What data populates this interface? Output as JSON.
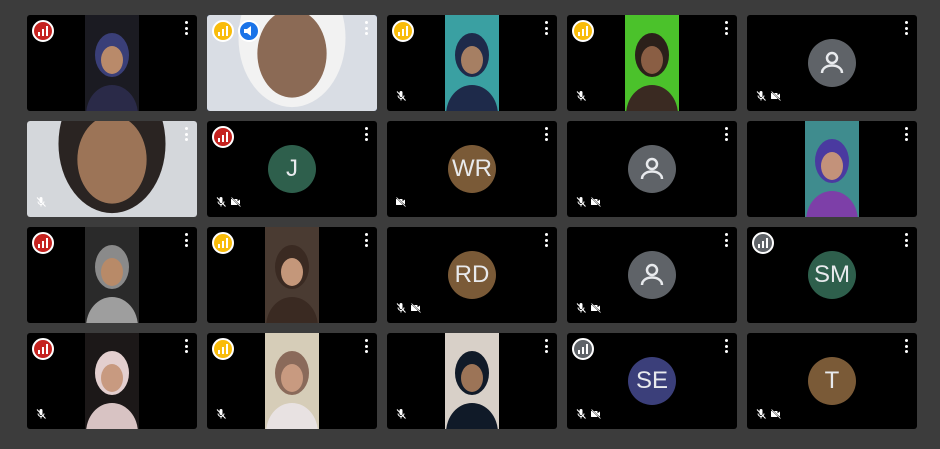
{
  "colors": {
    "background": "#3c3c3c",
    "tile": "#000000",
    "active_border": "#2f6ed6",
    "signal_red": "#c5221f",
    "signal_yellow": "#f9bc0a",
    "signal_gray": "#5f6368",
    "presenting_blue": "#1a73e8"
  },
  "participants": [
    {
      "kind": "video",
      "signal": "red",
      "mic_off": false,
      "cam_off": false,
      "bg": "#1b1b22",
      "face": "#b98a6a",
      "cloth": "#2a2a48",
      "hijab": "#3a3f78"
    },
    {
      "kind": "video",
      "signal": "yellow",
      "presenting": true,
      "active": true,
      "mic_off": false,
      "cam_off": false,
      "bg": "#d9dde4",
      "face": "#8b6a55",
      "cloth": "#e8e8ec",
      "hijab": "#f2f2f2",
      "wide": true
    },
    {
      "kind": "video",
      "signal": "yellow",
      "mic_off": true,
      "cam_off": false,
      "bg": "#3aa0a2",
      "face": "#a67f63",
      "cloth": "#1e2a4a",
      "hijab": "#1e2a4a"
    },
    {
      "kind": "video",
      "signal": "yellow",
      "mic_off": true,
      "cam_off": false,
      "bg": "#4bc22b",
      "face": "#8a5e44",
      "cloth": "#3a2a22",
      "hijab": "#2b201a"
    },
    {
      "kind": "person",
      "mic_off": true,
      "cam_off": true
    },
    {
      "kind": "video",
      "mic_off": true,
      "cam_off": false,
      "bg": "#d4d7db",
      "face": "#9c7457",
      "cloth": "#4c5560",
      "hijab": "#2a2422",
      "wide": true
    },
    {
      "kind": "initials",
      "initials": "J",
      "color": "#2e5f4c",
      "signal": "red",
      "mic_off": true,
      "cam_off": true
    },
    {
      "kind": "initials",
      "initials": "WR",
      "color": "#7a5a37",
      "mic_off": false,
      "cam_off": true
    },
    {
      "kind": "person",
      "mic_off": true,
      "cam_off": true
    },
    {
      "kind": "video",
      "mic_off": false,
      "cam_off": false,
      "bg": "#3f8c8e",
      "face": "#c3927a",
      "cloth": "#7d3fa8",
      "hijab": "#4a3aa0"
    },
    {
      "kind": "video",
      "signal": "red",
      "mic_off": false,
      "cam_off": false,
      "bg": "#2a2a2a",
      "face": "#b88a68",
      "cloth": "#9e9e9e",
      "hijab": "#8a8a8a"
    },
    {
      "kind": "video",
      "signal": "yellow",
      "mic_off": false,
      "cam_off": false,
      "bg": "#4a3b32",
      "face": "#c4977a",
      "cloth": "#3a2a22",
      "hijab": "#3a2a22"
    },
    {
      "kind": "initials",
      "initials": "RD",
      "color": "#7a5a37",
      "mic_off": true,
      "cam_off": true
    },
    {
      "kind": "person",
      "mic_off": true,
      "cam_off": true
    },
    {
      "kind": "initials",
      "initials": "SM",
      "color": "#2e5f4c",
      "signal": "gray",
      "mic_off": false,
      "cam_off": false
    },
    {
      "kind": "video",
      "signal": "red",
      "mic_off": true,
      "cam_off": false,
      "bg": "#1c1818",
      "face": "#c89a80",
      "cloth": "#d8c3c3",
      "hijab": "#e3cfcf"
    },
    {
      "kind": "video",
      "signal": "yellow",
      "mic_off": true,
      "cam_off": false,
      "bg": "#d6cdb8",
      "face": "#c89a80",
      "cloth": "#e8e2e2",
      "hijab": "#8a6a5a"
    },
    {
      "kind": "video",
      "mic_off": true,
      "cam_off": false,
      "bg": "#d8d0c8",
      "face": "#9c7457",
      "cloth": "#101a28",
      "hijab": "#101a28"
    },
    {
      "kind": "initials",
      "initials": "SE",
      "color": "#3b3f7a",
      "signal": "gray",
      "mic_off": true,
      "cam_off": true
    },
    {
      "kind": "initials",
      "initials": "T",
      "color": "#7a5a37",
      "mic_off": true,
      "cam_off": true
    }
  ]
}
